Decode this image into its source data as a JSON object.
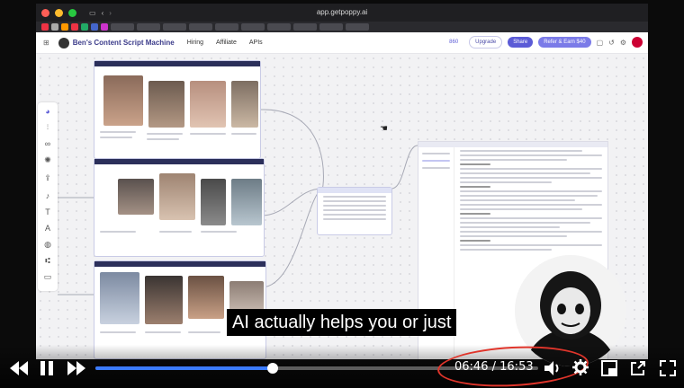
{
  "browser": {
    "url": "app.getpoppy.ai"
  },
  "app": {
    "title": "Ben's Content Script Machine",
    "nav": {
      "hiring": "Hiring",
      "affiliate": "Affiliate",
      "apis": "APIs"
    },
    "credits": "860",
    "upgrade_label": "Upgrade",
    "share_label": "Share",
    "refer_label": "Refer & Earn $40"
  },
  "caption": {
    "text": "AI actually helps you or just"
  },
  "player": {
    "current_time": "06:46",
    "separator": "/",
    "duration": "16:53",
    "progress": 0.4,
    "accent_color": "#3b7bff",
    "annotation_color": "#e0352b"
  },
  "icons": {
    "back": "skip-back-icon",
    "pause": "pause-icon",
    "forward": "skip-forward-icon",
    "volume": "volume-icon",
    "settings": "gear-icon",
    "pip": "picture-in-picture-icon",
    "share": "share-out-icon",
    "fullscreen": "fullscreen-icon"
  }
}
